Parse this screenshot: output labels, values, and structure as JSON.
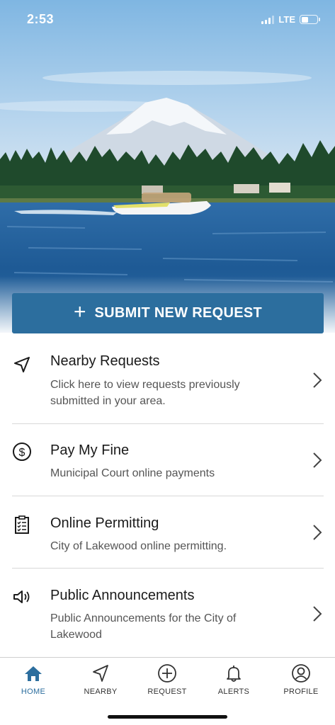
{
  "status": {
    "time": "2:53",
    "network": "LTE"
  },
  "submit": {
    "icon": "plus-icon",
    "label": "SUBMIT NEW REQUEST"
  },
  "items": [
    {
      "icon": "navigation-arrow-icon",
      "title": "Nearby Requests",
      "description": "Click here to view requests previously submitted in your area."
    },
    {
      "icon": "dollar-circle-icon",
      "title": "Pay My Fine",
      "description": "Municipal Court online payments"
    },
    {
      "icon": "clipboard-checklist-icon",
      "title": "Online Permitting",
      "description": "City of Lakewood online permitting."
    },
    {
      "icon": "megaphone-icon",
      "title": "Public Announcements",
      "description": "Public Announcements for the City of Lakewood"
    }
  ],
  "tabs": [
    {
      "icon": "home-icon",
      "label": "HOME",
      "active": true
    },
    {
      "icon": "navigation-arrow-icon",
      "label": "NEARBY",
      "active": false
    },
    {
      "icon": "plus-circle-icon",
      "label": "REQUEST",
      "active": false
    },
    {
      "icon": "bell-icon",
      "label": "ALERTS",
      "active": false
    },
    {
      "icon": "user-circle-icon",
      "label": "PROFILE",
      "active": false
    }
  ],
  "colors": {
    "accent": "#2c6e9e",
    "text": "#1a1a1a",
    "muted": "#555555",
    "divider": "#d8d8d8"
  }
}
